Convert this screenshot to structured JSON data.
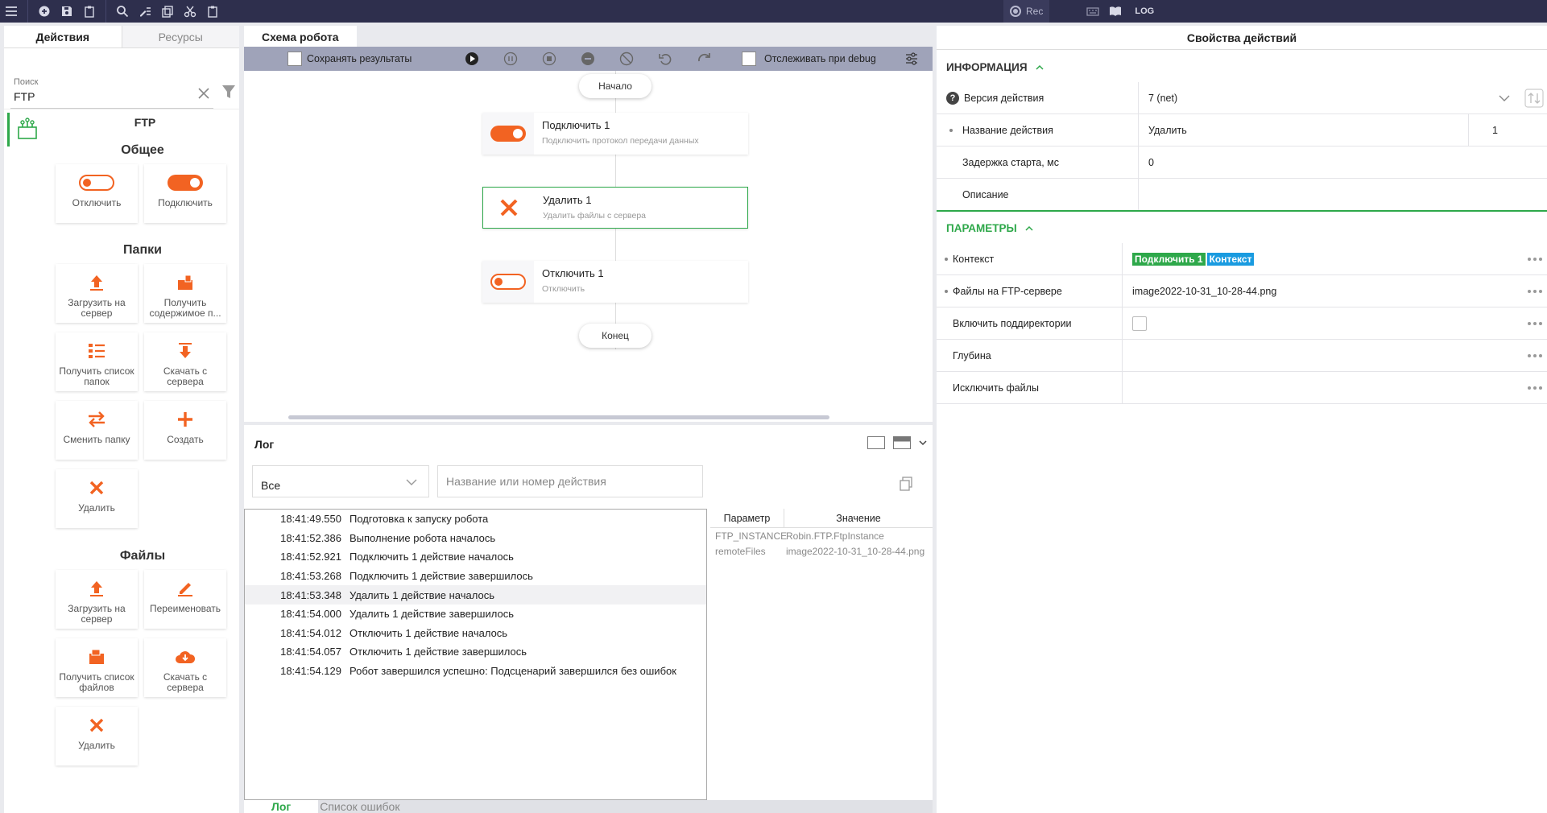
{
  "toolbar": {
    "rec_label": "Rec",
    "log_label": "LOG"
  },
  "left": {
    "tabs": [
      "Действия",
      "Ресурсы"
    ],
    "search_label": "Поиск",
    "search_value": "FTP",
    "category_title": "FTP",
    "sections": {
      "general": "Общее",
      "folders": "Папки",
      "files": "Файлы"
    },
    "general_items": [
      "Отключить",
      "Подключить"
    ],
    "folder_items": [
      "Загрузить на сервер",
      "Получить содержимое п...",
      "Получить список папок",
      "Скачать с сервера",
      "Сменить папку",
      "Создать",
      "Удалить"
    ],
    "file_items": [
      "Загрузить на сервер",
      "Переименовать",
      "Получить список файлов",
      "Скачать с сервера",
      "Удалить"
    ]
  },
  "center": {
    "tab": "Схема робота",
    "toolbar": {
      "save_results": "Сохранять результаты",
      "track_debug": "Отслеживать при debug"
    },
    "start": "Начало",
    "end": "Конец",
    "nodes": [
      {
        "title": "Подключить  1",
        "subtitle": "Подключить протокол передачи данных"
      },
      {
        "title": "Удалить  1",
        "subtitle": "Удалить файлы с сервера"
      },
      {
        "title": "Отключить  1",
        "subtitle": "Отключить"
      }
    ]
  },
  "log": {
    "title": "Лог",
    "filter_value": "Все",
    "search_placeholder": "Название или номер действия",
    "rows": [
      {
        "time": "18:41:49.550",
        "text": "Подготовка к запуску робота"
      },
      {
        "time": "18:41:52.386",
        "text": "Выполнение робота началось"
      },
      {
        "time": "18:41:52.921",
        "text": "Подключить 1 действие началось"
      },
      {
        "time": "18:41:53.268",
        "text": "Подключить 1 действие завершилось"
      },
      {
        "time": "18:41:53.348",
        "text": "Удалить 1 действие началось"
      },
      {
        "time": "18:41:54.000",
        "text": "Удалить 1 действие завершилось"
      },
      {
        "time": "18:41:54.012",
        "text": "Отключить 1 действие началось"
      },
      {
        "time": "18:41:54.057",
        "text": "Отключить 1 действие завершилось"
      },
      {
        "time": "18:41:54.129",
        "text": "Робот завершился успешно: Подсценарий завершился без ошибок"
      }
    ],
    "params_header": {
      "param": "Параметр",
      "value": "Значение"
    },
    "params": [
      {
        "param": "FTP_INSTANCE",
        "value": "Robin.FTP.FtpInstance"
      },
      {
        "param": "remoteFiles",
        "value": "image2022-10-31_10-28-44.png"
      }
    ],
    "bottom_tabs": [
      "Лог",
      "Список ошибок"
    ]
  },
  "right": {
    "title": "Свойства действий",
    "info_section": "ИНФОРМАЦИЯ",
    "params_section": "ПАРАМЕТРЫ",
    "info": {
      "version_label": "Версия действия",
      "version_value": "7 (net)",
      "name_label": "Название действия",
      "name_value": "Удалить",
      "name_index": "1",
      "delay_label": "Задержка старта, мс",
      "delay_value": "0",
      "desc_label": "Описание",
      "desc_value": ""
    },
    "params": {
      "context_label": "Контекст",
      "context_tag1": "Подключить 1",
      "context_tag2": "Контекст",
      "files_label": "Файлы на FTP-сервере",
      "files_value": "image2022-10-31_10-28-44.png",
      "subdirs_label": "Включить поддиректории",
      "depth_label": "Глубина",
      "exclude_label": "Исключить файлы"
    }
  },
  "colors": {
    "accent": "#f26322",
    "green": "#2ea84a",
    "blue_tag": "#1a9be0",
    "topbar": "#2e2f4d"
  }
}
